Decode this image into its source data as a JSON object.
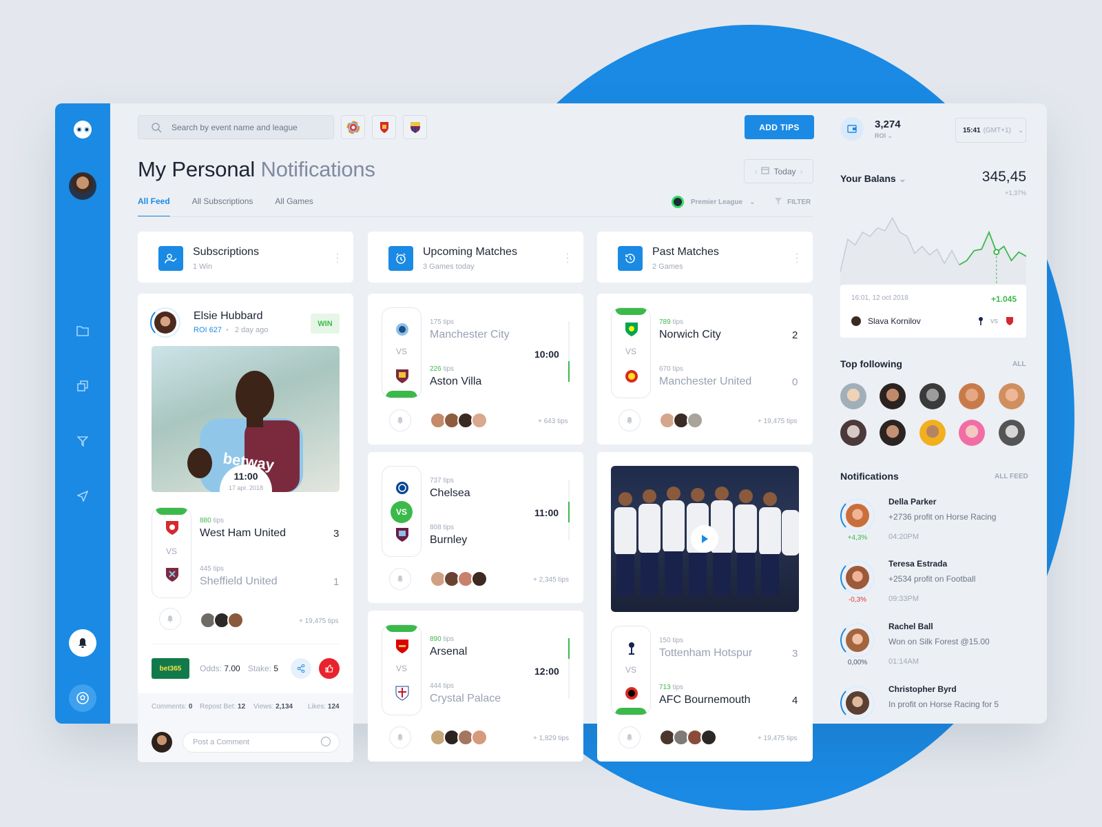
{
  "search": {
    "placeholder": "Search by event name and league"
  },
  "actions": {
    "add_tips": "ADD TIPS",
    "today": "Today"
  },
  "page": {
    "title_bold": "My Personal",
    "title_light": "Notifications"
  },
  "tabs": [
    "All Feed",
    "All Subscriptions",
    "All Games"
  ],
  "filters": {
    "league": "Premier League",
    "filter": "FILTER"
  },
  "columns": [
    {
      "title": "Subscriptions",
      "sub": "1 Win"
    },
    {
      "title": "Upcoming Matches",
      "sub": "3 Games today"
    },
    {
      "title": "Past Matches",
      "sub": "2 Games"
    }
  ],
  "post": {
    "user": "Elsie Hubbard",
    "roi": "ROI 627",
    "ago": "2 day ago",
    "badge": "WIN",
    "time": "11:00",
    "date": "17 apr. 2018",
    "match": {
      "home_tips": "880",
      "home": "West Ham United",
      "home_score": "3",
      "away_tips": "445",
      "away": "Sheffield United",
      "away_score": "1",
      "more": "+ 19,475 tips"
    },
    "bookmaker": "bet365",
    "odds_label": "Odds:",
    "odds": "7.00",
    "stake_label": "Stake:",
    "stake": "5",
    "comments_label": "Comments:",
    "comments": "0",
    "repost_label": "Repost Bet:",
    "repost": "12",
    "views_label": "Views:",
    "views": "2,134",
    "likes_label": "Likes:",
    "likes": "124",
    "comment_placeholder": "Post a Comment"
  },
  "tips_suffix": "tips",
  "vs": "VS",
  "upcoming": [
    {
      "home_tips": "175",
      "home": "Manchester City",
      "away_tips": "226",
      "away": "Aston Villa",
      "time": "10:00",
      "more": "+ 643 tips"
    },
    {
      "home_tips": "737",
      "home": "Chelsea",
      "away_tips": "808",
      "away": "Burnley",
      "time": "11:00",
      "more": "+ 2,345 tips"
    },
    {
      "home_tips": "890",
      "home": "Arsenal",
      "away_tips": "444",
      "away": "Crystal Palace",
      "time": "12:00",
      "more": "+ 1,829 tips"
    }
  ],
  "past": [
    {
      "home_tips": "789",
      "home": "Norwich City",
      "home_score": "2",
      "away_tips": "670",
      "away": "Manchester United",
      "away_score": "0",
      "more": "+ 19,475 tips"
    },
    {
      "home_tips": "150",
      "home": "Tottenham Hotspur",
      "home_score": "3",
      "away_tips": "713",
      "away": "AFC Bournemouth",
      "away_score": "4",
      "more": "+ 19,475 tips"
    }
  ],
  "balance": {
    "roi_value": "3,274",
    "roi_label": "ROI",
    "clock": "15:41",
    "tz": "(GMT+1)",
    "label": "Your Balans",
    "value": "345,45",
    "change": "+1,37%"
  },
  "chart_data": {
    "type": "line",
    "title": "",
    "xlabel": "",
    "ylabel": "",
    "series": [
      {
        "values": [
          14,
          60,
          52,
          70,
          64,
          76,
          72,
          90,
          70,
          64,
          40,
          50,
          38,
          46,
          26,
          44,
          24,
          30,
          44,
          46,
          70,
          42,
          50,
          30,
          42,
          36
        ]
      }
    ],
    "highlight_index": 21,
    "tooltip": {
      "date": "16:01, 12 oct 2018",
      "value": "+1.045",
      "user": "Slava Kornilov",
      "vs": "vs"
    }
  },
  "top_following": {
    "title": "Top following",
    "link": "ALL"
  },
  "notifications": {
    "title": "Notifications",
    "link": "ALL FEED",
    "items": [
      {
        "name": "Della Parker",
        "text": "+2736 profit on Horse Racing",
        "time": "04:20PM",
        "pct": "+4,3%"
      },
      {
        "name": "Teresa Estrada",
        "text": "+2534 profit on Football",
        "time": "09:33PM",
        "pct": "-0,3%"
      },
      {
        "name": "Rachel Ball",
        "text": "Won on Silk Forest @15.00",
        "time": "01:14AM",
        "pct": "0,00%"
      },
      {
        "name": "Christopher Byrd",
        "text": "In profit on Horse Racing for 5",
        "time": "",
        "pct": ""
      }
    ]
  },
  "colors": {
    "accent": "#1a8ae4",
    "win": "#3cb94b",
    "loss": "#e03a3a",
    "bookmaker": "#127a4a"
  }
}
